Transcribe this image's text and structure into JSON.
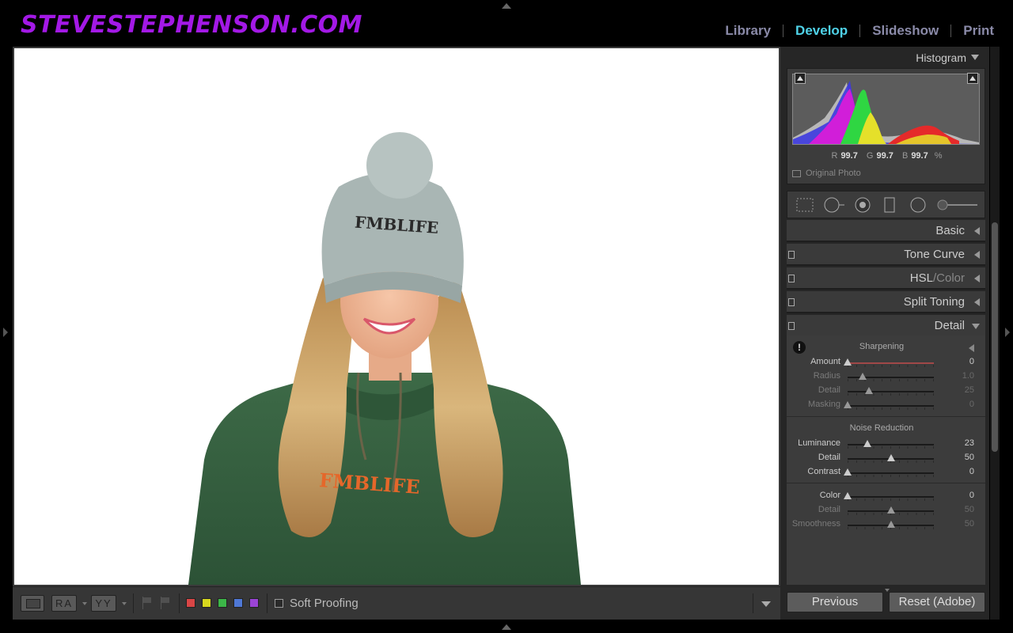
{
  "brand": {
    "logo_text": "STEVESTEPHENSON.COM",
    "logo_color": "#a319e6"
  },
  "modules": [
    {
      "label": "Library",
      "active": false
    },
    {
      "label": "Develop",
      "active": true
    },
    {
      "label": "Slideshow",
      "active": false
    },
    {
      "label": "Print",
      "active": false
    }
  ],
  "photo": {
    "description": "Smiling young woman with long wavy blonde hair wearing a grey knit pom-pom beanie and a green hoodie on a white background",
    "hat_text": "FMBLIFE",
    "hoodie_text": "FMBLIFE",
    "hoodie_text_color": "#e5672a"
  },
  "toolbar": {
    "view_ra": "RA",
    "view_yy": "YY",
    "color_labels": [
      "#d94646",
      "#d8d81e",
      "#3cb648",
      "#4f78d6",
      "#9b44d6"
    ],
    "soft_proofing_label": "Soft Proofing",
    "soft_proofing_checked": false
  },
  "histogram": {
    "title": "Histogram",
    "r_label": "R",
    "r_value": "99.7",
    "g_label": "G",
    "g_value": "99.7",
    "b_label": "B",
    "b_value": "99.7",
    "unit": "%",
    "original_photo_label": "Original Photo"
  },
  "sections": {
    "basic": "Basic",
    "tone_curve": "Tone Curve",
    "hsl": "HSL",
    "hsl_sep": " / ",
    "color": "Color",
    "split_toning": "Split Toning",
    "detail": "Detail"
  },
  "sharpening": {
    "title": "Sharpening",
    "sliders": [
      {
        "label": "Amount",
        "value": "0",
        "fraction": 0.0
      },
      {
        "label": "Radius",
        "value": "1.0",
        "fraction": 0.17
      },
      {
        "label": "Detail",
        "value": "25",
        "fraction": 0.25
      },
      {
        "label": "Masking",
        "value": "0",
        "fraction": 0.0
      }
    ]
  },
  "noise_reduction": {
    "title": "Noise Reduction",
    "luminance_sliders": [
      {
        "label": "Luminance",
        "value": "23",
        "fraction": 0.23
      },
      {
        "label": "Detail",
        "value": "50",
        "fraction": 0.5
      },
      {
        "label": "Contrast",
        "value": "0",
        "fraction": 0.0
      }
    ],
    "color_sliders": [
      {
        "label": "Color",
        "value": "0",
        "fraction": 0.0
      },
      {
        "label": "Detail",
        "value": "50",
        "fraction": 0.5
      },
      {
        "label": "Smoothness",
        "value": "50",
        "fraction": 0.5
      }
    ]
  },
  "buttons": {
    "previous": "Previous",
    "reset": "Reset (Adobe)"
  }
}
